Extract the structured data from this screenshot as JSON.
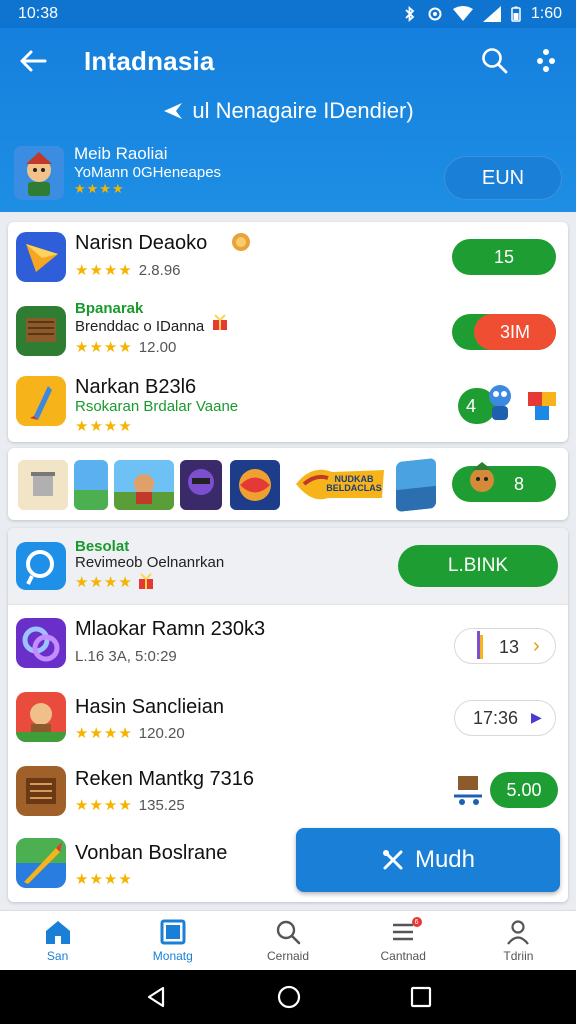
{
  "status_bar": {
    "time": "10:38",
    "battery": "1:60"
  },
  "app_bar": {
    "title": "Intadnasia",
    "subtitle": "ul Nenagaire IDendier)"
  },
  "featured": {
    "title": "Meib Raoliai",
    "subtitle": "YoMann 0GHeneapes",
    "stars": "★★★★",
    "button_label": "EUN"
  },
  "list_top": [
    {
      "title": "Narisn Deaoko",
      "stars": "★★★★",
      "rating": "2.8.96",
      "action_label": "15",
      "action_style": "green"
    },
    {
      "green_label": "Bpanarak",
      "subtitle": "Brenddac o IDanna",
      "stars": "★★★★",
      "rating": "12.00",
      "action_label": "3IM",
      "action_style": "red"
    },
    {
      "title": "Narkan B23l6",
      "green_label": "Rsokaran Brdalar Vaane",
      "stars": "★★★★",
      "action_label": "4"
    }
  ],
  "strip": {
    "banner_text": "NUDKAB BELDACLAS",
    "action_label": "8"
  },
  "highlight": {
    "green_label": "Besolat",
    "subtitle": "Revimeob Oelnanrkan",
    "stars": "★★★★",
    "button_label": "L.BINK"
  },
  "list_bottom": [
    {
      "title": "Mlaokar Ramn 230k3",
      "meta": "L.16 3A,  5:0:29",
      "action_label": "13"
    },
    {
      "title": "Hasin Sanclieian",
      "stars": "★★★★",
      "rating": "120.20",
      "action_label": "17:36"
    },
    {
      "title": "Reken Mantkg 7316",
      "stars": "★★★★",
      "rating": "135.25",
      "action_label": "5.00"
    },
    {
      "title": "Vonban Boslrane",
      "stars": "★★★★"
    }
  ],
  "fab": {
    "label": "Mudh"
  },
  "bottom_nav": [
    {
      "label": "San",
      "icon": "home-icon"
    },
    {
      "label": "Monatg",
      "icon": "square-icon"
    },
    {
      "label": "Cernaid",
      "icon": "search-icon"
    },
    {
      "label": "Cantnad",
      "icon": "list-icon",
      "badge": "6"
    },
    {
      "label": "Tdriin",
      "icon": "person-icon"
    }
  ],
  "colors": {
    "primary": "#1a7fd6",
    "green": "#1e9e32",
    "red": "#ef4e32",
    "star": "#f5b400"
  }
}
